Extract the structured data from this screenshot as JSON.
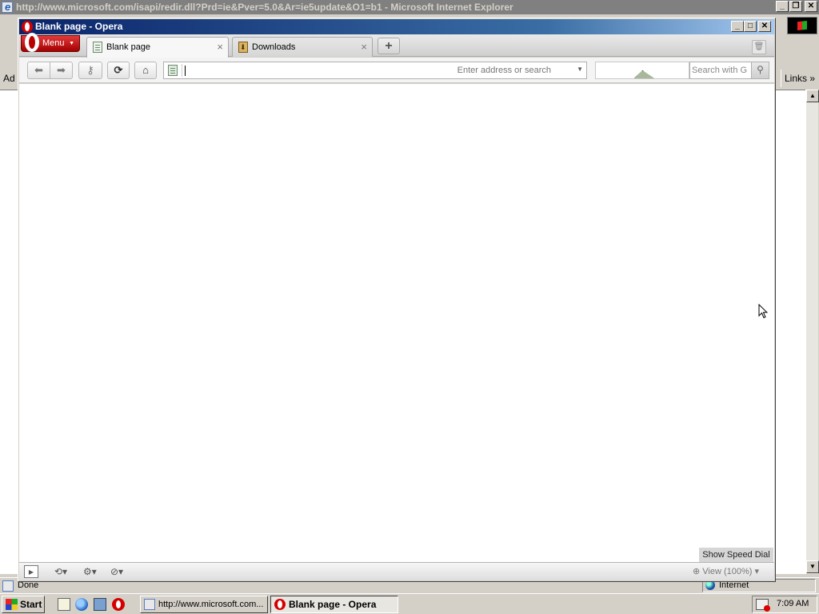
{
  "ie": {
    "title": "http://www.microsoft.com/isapi/redir.dll?Prd=ie&Pver=5.0&Ar=ie5update&O1=b1 - Microsoft Internet Explorer",
    "address_label": "Ad",
    "links_label": "Links",
    "links_chevron": "»",
    "status_text": "Done",
    "zone_text": "Internet"
  },
  "opera": {
    "title": "Blank page - Opera",
    "menu_label": "Menu",
    "tabs": [
      {
        "label": "Blank page",
        "icon": "page-icon",
        "active": true
      },
      {
        "label": "Downloads",
        "icon": "download-icon",
        "active": false
      }
    ],
    "tab_close_glyph": "×",
    "new_tab_glyph": "+",
    "address": {
      "value": "",
      "placeholder": "Enter address or search"
    },
    "search": {
      "value": "",
      "placeholder": "Search with G"
    },
    "speed_dial_label": "Show Speed Dial",
    "zoom_label": "View (100%)"
  },
  "taskbar": {
    "start_label": "Start",
    "tasks": [
      {
        "label": "http://www.microsoft.com...",
        "active": false
      },
      {
        "label": "Blank page - Opera",
        "active": true
      }
    ],
    "clock": "7:09 AM"
  },
  "colors": {
    "opera_red": "#d40000",
    "title_active": "#0a246a",
    "title_inactive": "#808080",
    "system_face": "#d4d0c8"
  }
}
